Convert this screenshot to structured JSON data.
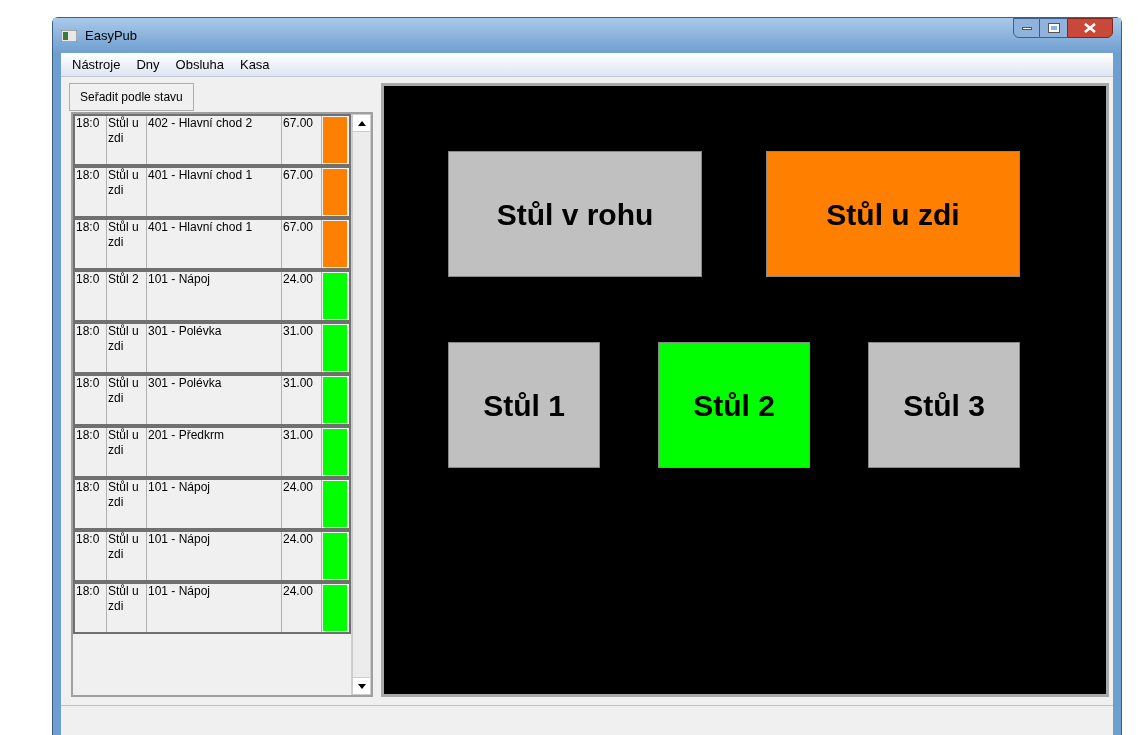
{
  "window": {
    "title": "EasyPub"
  },
  "menu": [
    "Nástroje",
    "Dny",
    "Obsluha",
    "Kasa"
  ],
  "sort_button": "Seřadit podle stavu",
  "orders": [
    {
      "time": "18:0",
      "table": "Stůl u zdi",
      "item": "402 - Hlavní chod 2",
      "price": "67.00",
      "color": "#ff8000"
    },
    {
      "time": "18:0",
      "table": "Stůl u zdi",
      "item": "401 - Hlavní chod 1",
      "price": "67.00",
      "color": "#ff8000"
    },
    {
      "time": "18:0",
      "table": "Stůl u zdi",
      "item": "401 - Hlavní chod 1",
      "price": "67.00",
      "color": "#ff8000"
    },
    {
      "time": "18:0",
      "table": "Stůl 2",
      "item": "101 - Nápoj",
      "price": "24.00",
      "color": "#00ff00"
    },
    {
      "time": "18:0",
      "table": "Stůl u zdi",
      "item": "301 - Polévka",
      "price": "31.00",
      "color": "#00ff00"
    },
    {
      "time": "18:0",
      "table": "Stůl u zdi",
      "item": "301 - Polévka",
      "price": "31.00",
      "color": "#00ff00"
    },
    {
      "time": "18:0",
      "table": "Stůl u zdi",
      "item": "201 - Předkrm",
      "price": "31.00",
      "color": "#00ff00"
    },
    {
      "time": "18:0",
      "table": "Stůl u zdi",
      "item": "101 - Nápoj",
      "price": "24.00",
      "color": "#00ff00"
    },
    {
      "time": "18:0",
      "table": "Stůl u zdi",
      "item": "101 - Nápoj",
      "price": "24.00",
      "color": "#00ff00"
    },
    {
      "time": "18:0",
      "table": "Stůl u zdi",
      "item": "101 - Nápoj",
      "price": "24.00",
      "color": "#00ff00"
    }
  ],
  "tables": [
    {
      "label": "Stůl v rohu",
      "color": "#c0c0c0"
    },
    {
      "label": "Stůl u zdi",
      "color": "#ff8000"
    },
    {
      "label": "Stůl 1",
      "color": "#c0c0c0"
    },
    {
      "label": "Stůl 2",
      "color": "#00ff00"
    },
    {
      "label": "Stůl 3",
      "color": "#c0c0c0"
    }
  ]
}
